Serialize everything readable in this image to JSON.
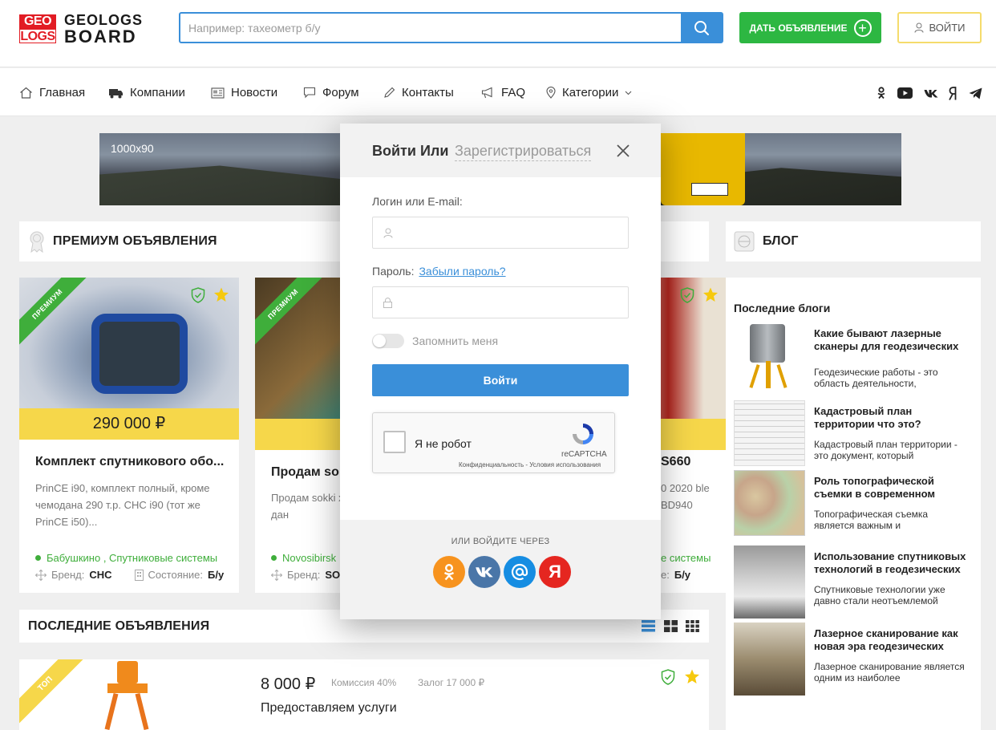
{
  "header": {
    "logo_line1": "GEO",
    "logo_line2": "LOGS",
    "brand_line1": "GEOLOGS",
    "brand_line2": "BOARD",
    "search_placeholder": "Например: тахеометр б/у",
    "post_button": "ДАТЬ ОБЪЯВЛЕНИЕ",
    "login_button": "ВОЙТИ"
  },
  "nav": {
    "items": [
      "Главная",
      "Компании",
      "Новости",
      "Форум",
      "Контакты",
      "FAQ",
      "Категории"
    ],
    "social": [
      "odnoklassniki-icon",
      "youtube-icon",
      "vk-icon",
      "yandex-icon",
      "telegram-icon"
    ]
  },
  "banner": {
    "label": "1000x90"
  },
  "premium": {
    "title": "ПРЕМИУМ ОБЪЯВЛЕНИЯ",
    "ribbon": "ПРЕМИУМ",
    "cards": [
      {
        "price": "290 000 ₽",
        "title": "Комплект спутникового обо...",
        "desc": "PrinCE i90, комплект полный, кроме чемодана 290 т.р. CHC i90 (тот же PrinCE i50)...",
        "location": "Бабушкино , Спутниковые системы",
        "brand_label": "Бренд:",
        "brand": "CHC",
        "state_label": "Состояние:",
        "state": "Б/у"
      },
      {
        "title": "Продам sok",
        "desc": "Продам sokki хорошем сос передачи дан",
        "location": "Novosibirsk",
        "brand_label": "Бренд:",
        "brand": "SO"
      },
      {
        "title": "S660",
        "desc": "0 2020 ble BD940",
        "location": "е системы",
        "state_label": "е:",
        "state": "Б/у"
      }
    ]
  },
  "blog": {
    "title": "БЛОГ",
    "subtitle": "Последние блоги",
    "items": [
      {
        "title": "Какие бывают лазерные сканеры для геодезических работ",
        "desc": "Геодезические работы - это область деятельности,"
      },
      {
        "title": "Кадастровый план территории что это?",
        "desc": "Кадастровый план территории - это документ, который"
      },
      {
        "title": "Роль топографической съемки в современном строительстве",
        "desc": "Топографическая съемка является важным и"
      },
      {
        "title": "Использование спутниковых технологий в геодезических работах: революция в",
        "desc": "Спутниковые технологии уже давно стали неотъемлемой"
      },
      {
        "title": "Лазерное сканирование как новая эра геодезических изысканий",
        "desc": "Лазерное сканирование является одним из наиболее"
      }
    ]
  },
  "latest": {
    "title": "ПОСЛЕДНИЕ ОБЪЯВЛЕНИЯ",
    "ribbon": "ТОП",
    "price": "8 000 ₽",
    "commission": "Комиссия 40%",
    "deposit": "Залог 17 000 ₽",
    "listing_title": "Предоставляем услуги"
  },
  "modal": {
    "title": "Войти Или",
    "register_tab": "Зарегистрироваться",
    "login_label": "Логин или E-mail:",
    "password_label": "Пароль:",
    "forgot_link": "Забыли пароль?",
    "remember": "Запомнить меня",
    "submit": "Войти",
    "captcha_text": "Я не робот",
    "captcha_brand": "reCAPTCHA",
    "captcha_small": "Конфиденциальность - Условия использования",
    "or_text": "ИЛИ ВОЙДИТЕ ЧЕРЕЗ",
    "oauth": [
      {
        "name": "odnoklassniki",
        "color": "#f7931e"
      },
      {
        "name": "vk",
        "color": "#4a76a8"
      },
      {
        "name": "mailru",
        "color": "#168de2"
      },
      {
        "name": "yandex",
        "color": "#e52620",
        "glyph": "Я"
      }
    ]
  },
  "colors": {
    "accent": "#3a8fd9",
    "green": "#2db742",
    "yellow": "#f6d74a",
    "logo_red": "#e21c24"
  }
}
